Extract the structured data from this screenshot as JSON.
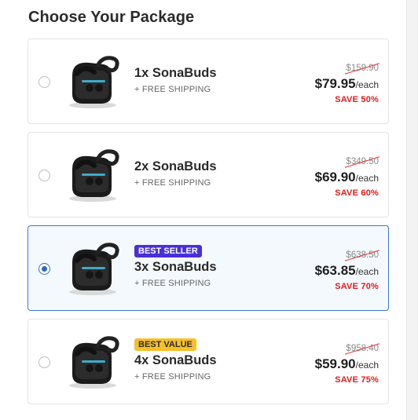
{
  "page": {
    "title": "Choose Your Package"
  },
  "colors": {
    "best_seller_badge": "#4a2fd6",
    "best_value_badge": "#f6c02b",
    "selected_border": "#3a78d3",
    "save_red": "#e01b1b"
  },
  "packages": [
    {
      "name": "1x SonaBuds",
      "shipping": "+ FREE SHIPPING",
      "old_price": "$159.90",
      "price": "$79.95",
      "unit": "/each",
      "save": "SAVE 50%",
      "badge": "",
      "selected": false
    },
    {
      "name": "2x SonaBuds",
      "shipping": "+ FREE SHIPPING",
      "old_price": "$349.50",
      "price": "$69.90",
      "unit": "/each",
      "save": "SAVE 60%",
      "badge": "",
      "selected": false
    },
    {
      "name": "3x SonaBuds",
      "shipping": "+ FREE SHIPPING",
      "old_price": "$638.50",
      "price": "$63.85",
      "unit": "/each",
      "save": "SAVE 70%",
      "badge": "BEST SELLER",
      "selected": true
    },
    {
      "name": "4x SonaBuds",
      "shipping": "+ FREE SHIPPING",
      "old_price": "$958.40",
      "price": "$59.90",
      "unit": "/each",
      "save": "SAVE 75%",
      "badge": "BEST VALUE",
      "selected": false
    }
  ],
  "icons": {
    "product": "earbuds-case-image",
    "radio": "radio-button"
  }
}
